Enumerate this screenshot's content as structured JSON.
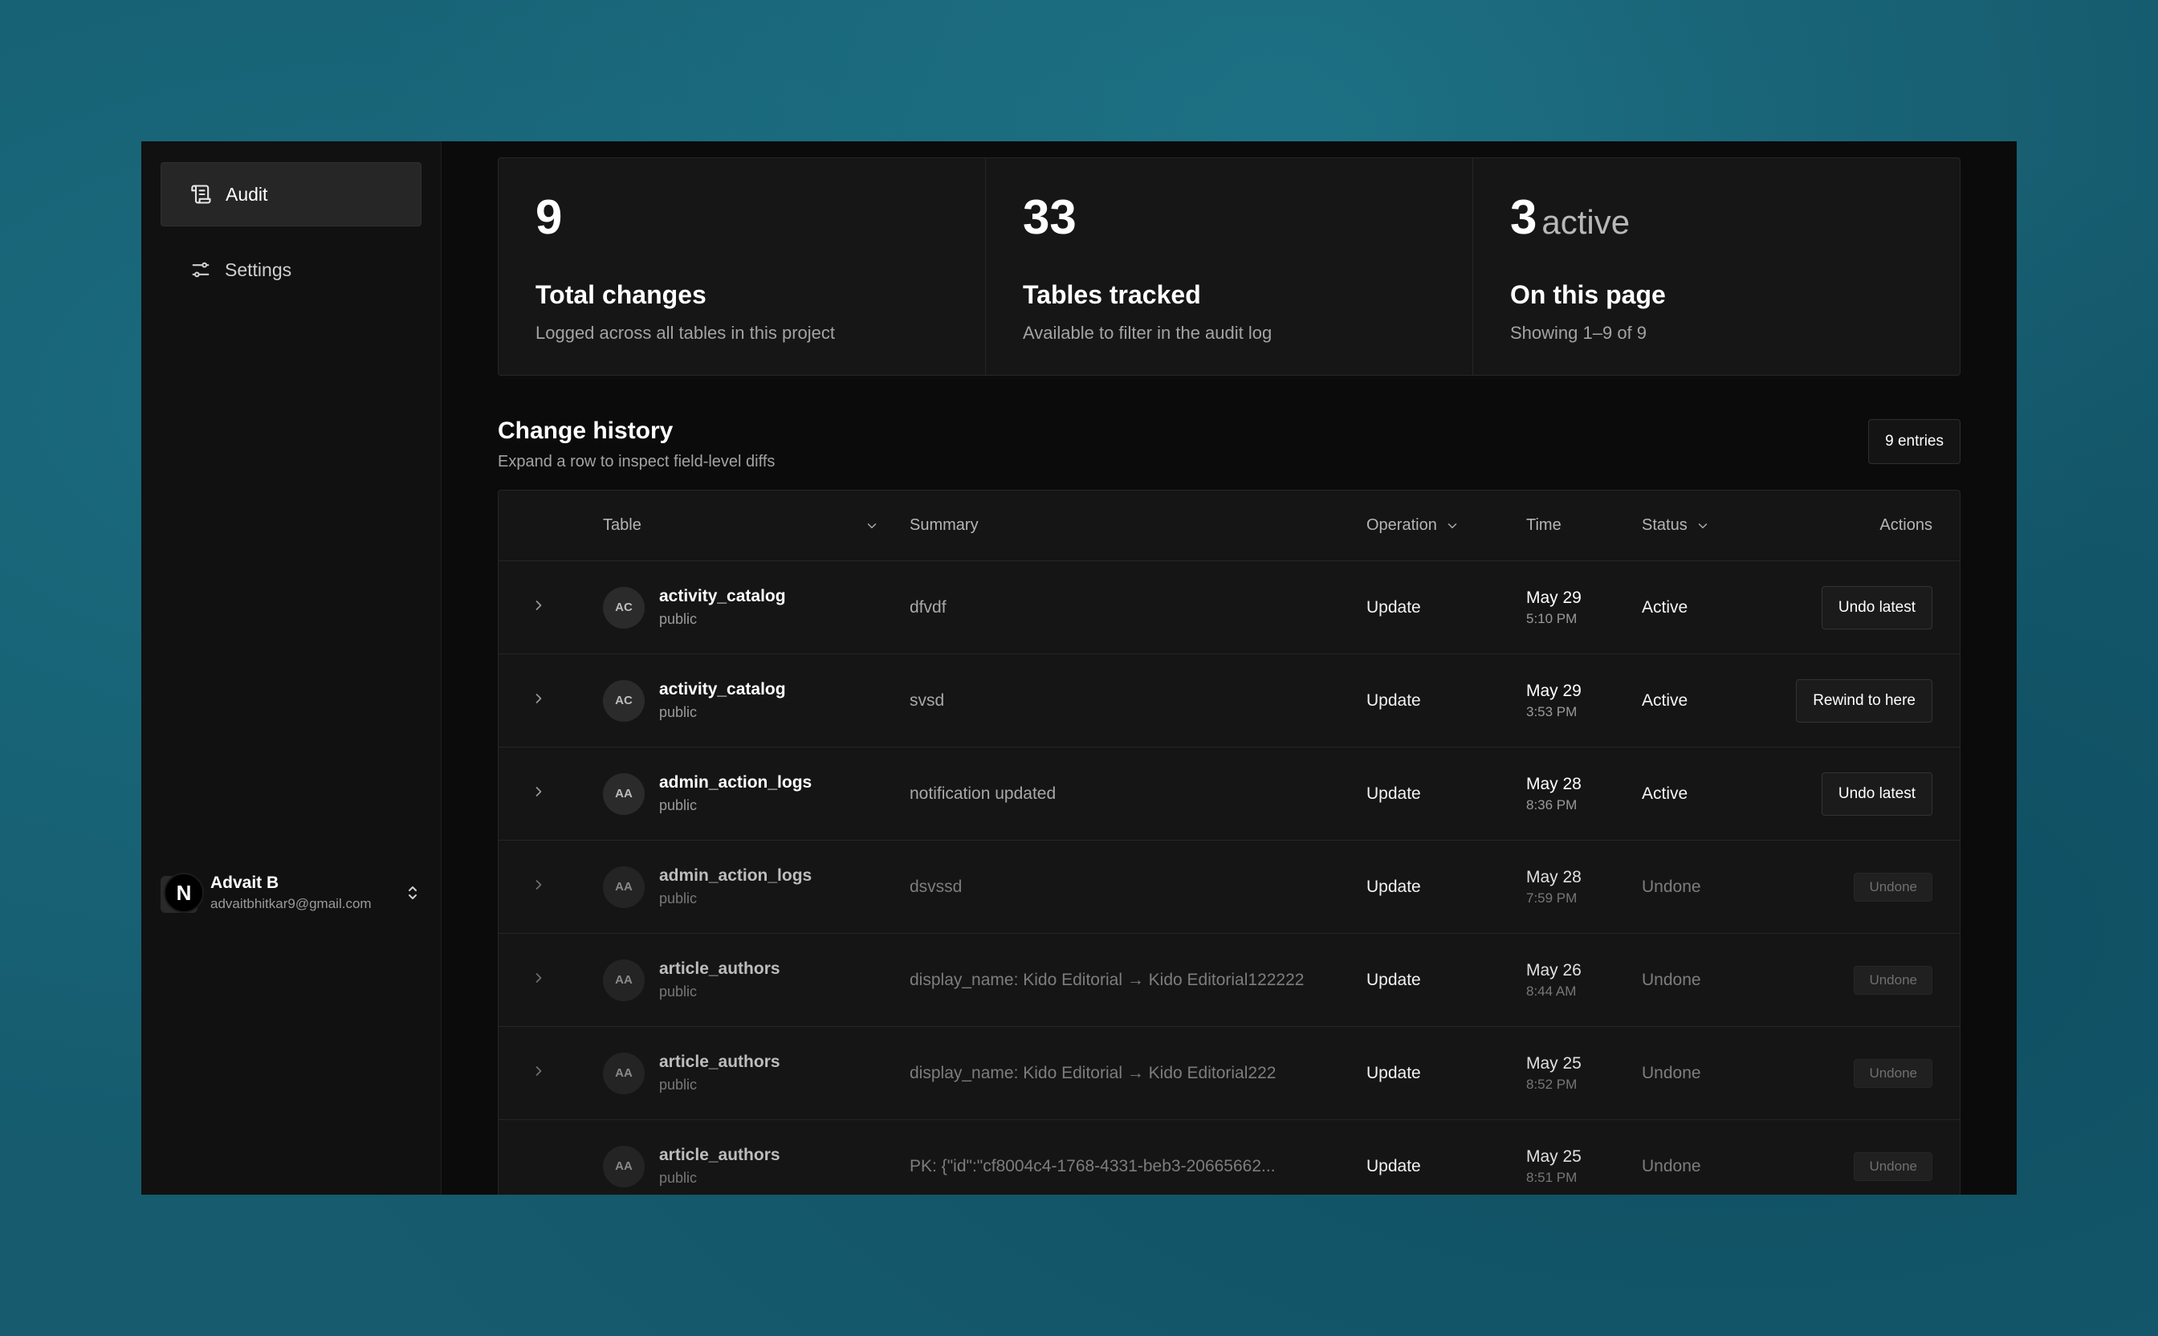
{
  "sidebar": {
    "items": [
      {
        "label": "Audit",
        "icon": "scroll-icon",
        "active": true
      },
      {
        "label": "Settings",
        "icon": "sliders-icon",
        "active": false
      }
    ],
    "user": {
      "initial": "N",
      "name": "Advait B",
      "email": "advaitbhitkar9@gmail.com"
    }
  },
  "stats": [
    {
      "value": "9",
      "suffix": "",
      "title": "Total changes",
      "desc": "Logged across all tables in this project"
    },
    {
      "value": "33",
      "suffix": "",
      "title": "Tables tracked",
      "desc": "Available to filter in the audit log"
    },
    {
      "value": "3",
      "suffix": "active",
      "title": "On this page",
      "desc": "Showing 1–9 of 9"
    }
  ],
  "history": {
    "title": "Change history",
    "subtitle": "Expand a row to inspect field-level diffs",
    "entries_badge": "9 entries",
    "columns": {
      "table": "Table",
      "summary": "Summary",
      "operation": "Operation",
      "time": "Time",
      "status": "Status",
      "actions": "Actions"
    },
    "rows": [
      {
        "initials": "AC",
        "table": "activity_catalog",
        "schema": "public",
        "summary": "dfvdf",
        "operation": "Update",
        "date": "May 29",
        "time": "5:10 PM",
        "status": "Active",
        "action": "Undo latest"
      },
      {
        "initials": "AC",
        "table": "activity_catalog",
        "schema": "public",
        "summary": "svsd",
        "operation": "Update",
        "date": "May 29",
        "time": "3:53 PM",
        "status": "Active",
        "action": "Rewind to here"
      },
      {
        "initials": "AA",
        "table": "admin_action_logs",
        "schema": "public",
        "summary": "notification updated",
        "operation": "Update",
        "date": "May 28",
        "time": "8:36 PM",
        "status": "Active",
        "action": "Undo latest"
      },
      {
        "initials": "AA",
        "table": "admin_action_logs",
        "schema": "public",
        "summary": "dsvssd",
        "operation": "Update",
        "date": "May 28",
        "time": "7:59 PM",
        "status": "Undone",
        "action": "Undone"
      },
      {
        "initials": "AA",
        "table": "article_authors",
        "schema": "public",
        "summary": "display_name: Kido Editorial → Kido Editorial122222",
        "operation": "Update",
        "date": "May 26",
        "time": "8:44 AM",
        "status": "Undone",
        "action": "Undone"
      },
      {
        "initials": "AA",
        "table": "article_authors",
        "schema": "public",
        "summary": "display_name: Kido Editorial → Kido Editorial222",
        "operation": "Update",
        "date": "May 25",
        "time": "8:52 PM",
        "status": "Undone",
        "action": "Undone"
      },
      {
        "initials": "AA",
        "table": "article_authors",
        "schema": "public",
        "summary": "PK: {\"id\":\"cf8004c4-1768-4331-beb3-20665662...",
        "operation": "Update",
        "date": "May 25",
        "time": "8:51 PM",
        "status": "Undone",
        "action": "Undone"
      }
    ]
  }
}
